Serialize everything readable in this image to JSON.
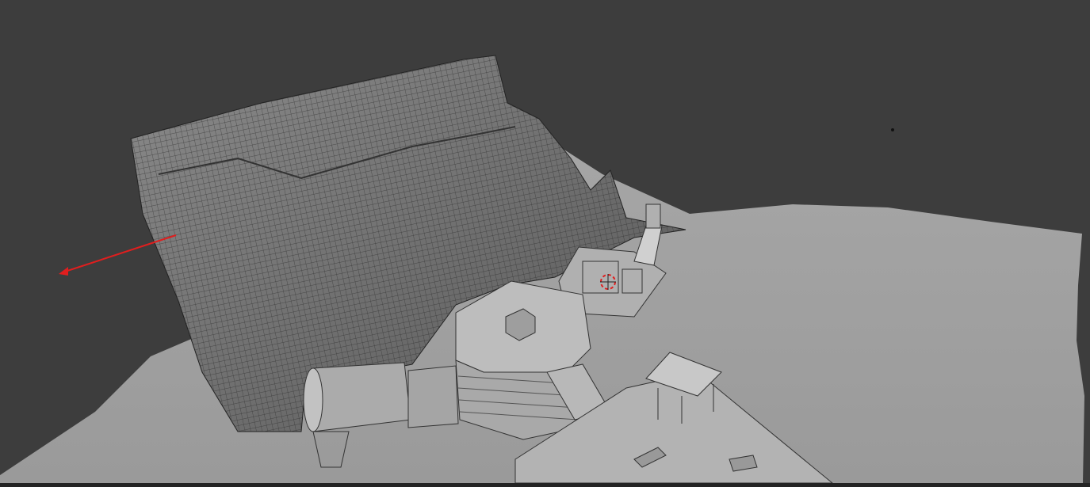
{
  "viewport": {
    "background_color": "#3d3d3d",
    "terrain_color": "#a8a8a8",
    "wire_mesh_color": "#707070",
    "building_color": "#b4b4b4",
    "arrow_color": "#e01e1e",
    "cursor_icon": "3d-cursor-icon"
  }
}
